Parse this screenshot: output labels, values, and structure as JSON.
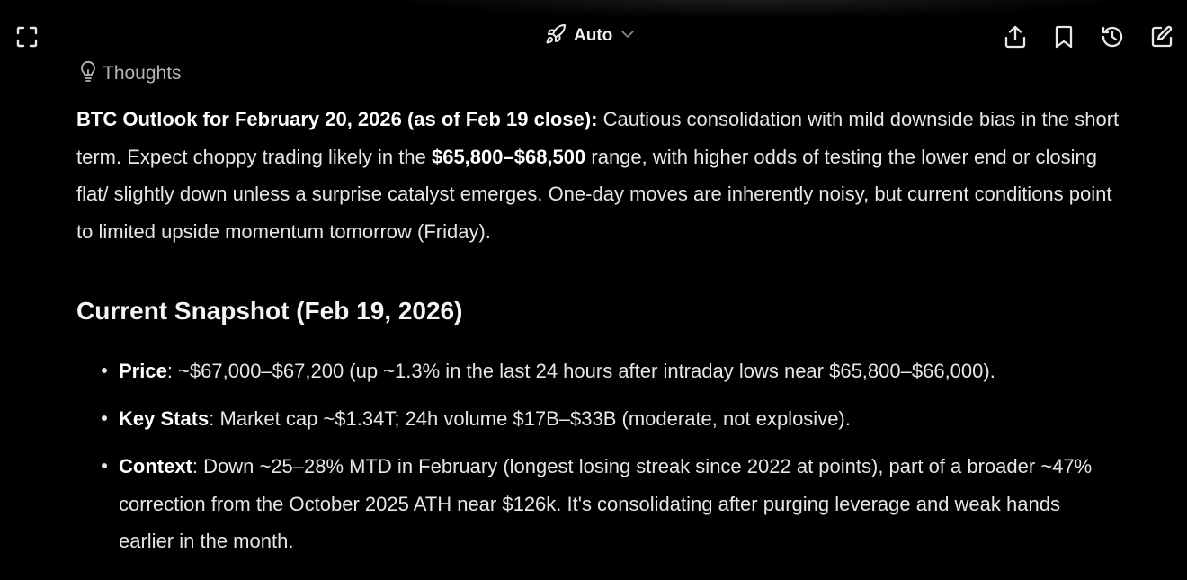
{
  "header": {
    "mode_label": "Auto",
    "icons": [
      "expand-icon",
      "rocket-icon",
      "chevron-down-icon",
      "share-icon",
      "bookmark-icon",
      "history-icon",
      "edit-icon"
    ]
  },
  "thoughts": {
    "label": "Thoughts",
    "icon": "lightbulb-icon"
  },
  "intro": {
    "bold_lead": "BTC Outlook for February 20, 2026 (as of Feb 19 close):",
    "text_1": " Cautious consolidation with mild downside bias in the short term. Expect choppy trading likely in the ",
    "range_bold": "$65,800–$68,500",
    "text_2": " range, with higher odds of testing the lower end or closing flat/ slightly down unless a surprise catalyst emerges. One-day moves are inherently noisy, but current conditions point to limited upside momentum tomorrow (Friday)."
  },
  "snapshot": {
    "heading": "Current Snapshot (Feb 19, 2026)",
    "items": [
      {
        "label": "Price",
        "text": ": ~$67,000–$67,200 (up ~1.3% in the last 24 hours after intraday lows near $65,800–$66,000)."
      },
      {
        "label": "Key Stats",
        "text": ": Market cap ~$1.34T; 24h volume $17B–$33B (moderate, not explosive)."
      },
      {
        "label": "Context",
        "text": ": Down ~25–28% MTD in February (longest losing streak since 2022 at points), part of a broader ~47% correction from the October 2025 ATH near $126k. It's consolidating after purging leverage and weak hands earlier in the month."
      }
    ]
  },
  "colors": {
    "background": "#000000",
    "text": "#e6e6e6",
    "muted": "#b5b5b5"
  }
}
